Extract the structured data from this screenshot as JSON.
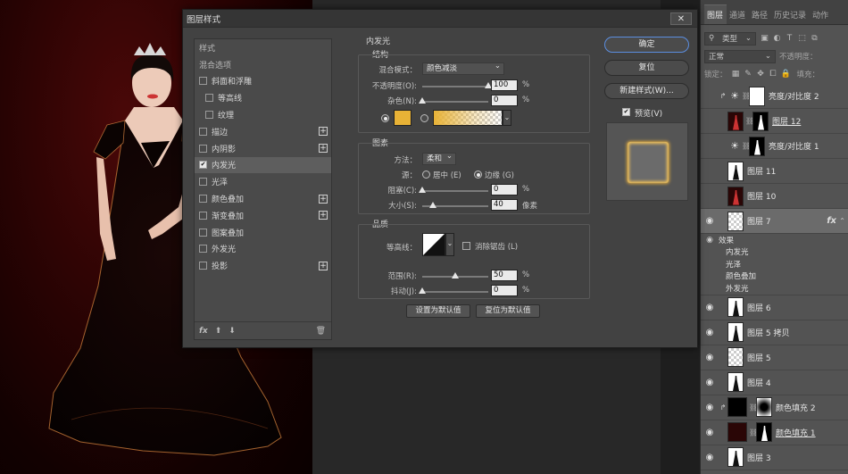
{
  "colors": {
    "accent": "#5b8ee0",
    "glow": "#e8b236",
    "panel": "#535353",
    "dialog": "#424242"
  },
  "dialog": {
    "title": "图层样式",
    "close_icon": "close-icon",
    "style_list": {
      "items": [
        {
          "label": "样式",
          "type": "head"
        },
        {
          "label": "混合选项",
          "type": "head"
        },
        {
          "label": "斜面和浮雕",
          "checked": false
        },
        {
          "label": "等高线",
          "checked": false,
          "indent": true
        },
        {
          "label": "纹理",
          "checked": false,
          "indent": true
        },
        {
          "label": "描边",
          "checked": false,
          "plus": true
        },
        {
          "label": "内阴影",
          "checked": false,
          "plus": true
        },
        {
          "label": "内发光",
          "checked": true,
          "selected": true
        },
        {
          "label": "光泽",
          "checked": false
        },
        {
          "label": "颜色叠加",
          "checked": false,
          "plus": true
        },
        {
          "label": "渐变叠加",
          "checked": false,
          "plus": true
        },
        {
          "label": "图案叠加",
          "checked": false
        },
        {
          "label": "外发光",
          "checked": false
        },
        {
          "label": "投影",
          "checked": false,
          "plus": true
        }
      ],
      "footer_fx": "fx"
    },
    "inner_glow": {
      "section_title": "内发光",
      "structure": {
        "title": "结构",
        "blend_mode_label": "混合模式：",
        "blend_mode_value": "颜色减淡",
        "opacity_label": "不透明度(O):",
        "opacity_value": "100",
        "opacity_pct": 100,
        "noise_label": "杂色(N):",
        "noise_value": "0",
        "noise_pct": 0,
        "unit": "%"
      },
      "elements": {
        "title": "图素",
        "method_label": "方法：",
        "method_value": "柔和",
        "source_label": "源：",
        "source_center": "居中 (E)",
        "source_edge": "边缘 (G)",
        "choke_label": "阻塞(C):",
        "choke_value": "0",
        "choke_pct": 0,
        "size_label": "大小(S):",
        "size_value": "40",
        "size_unit": "像素",
        "unit": "%"
      },
      "quality": {
        "title": "品质",
        "contour_label": "等高线：",
        "anti_alias_label": "消除锯齿 (L)",
        "range_label": "范围(R):",
        "range_value": "50",
        "range_pct": 50,
        "jitter_label": "抖动(J):",
        "jitter_value": "0",
        "jitter_pct": 0,
        "unit": "%"
      },
      "set_default": "设置为默认值",
      "reset_default": "复位为默认值"
    },
    "buttons": {
      "ok": "确定",
      "reset": "复位",
      "new_style": "新建样式(W)...",
      "preview": "预览(V)"
    }
  },
  "layers_panel": {
    "tabs": [
      "图层",
      "通道",
      "路径",
      "历史记录",
      "动作"
    ],
    "filter_kind": "类型",
    "blend_mode": "正常",
    "opacity_label": "不透明度：",
    "lock_label": "锁定：",
    "fill_label": "填充：",
    "layers": [
      {
        "name": "亮度/对比度 2",
        "visible": false,
        "clip": true,
        "kind": "adjust",
        "mask": "white"
      },
      {
        "name": "图层 12",
        "visible": false,
        "clip": false,
        "kind": "dark",
        "mask": "figure",
        "underline": true
      },
      {
        "name": "亮度/对比度 1",
        "visible": false,
        "clip": false,
        "kind": "adjust",
        "mask": "figure"
      },
      {
        "name": "图层 11",
        "visible": false,
        "clip": false,
        "kind": "white"
      },
      {
        "name": "图层 10",
        "visible": false,
        "clip": false,
        "kind": "dark"
      },
      {
        "name": "图层 7",
        "visible": true,
        "clip": false,
        "kind": "checker",
        "selected": true,
        "fx": "fx"
      }
    ],
    "effects_title": "效果",
    "effects": [
      "内发光",
      "光泽",
      "颜色叠加",
      "外发光"
    ],
    "layers_after": [
      {
        "name": "图层 6",
        "visible": true,
        "kind": "white"
      },
      {
        "name": "图层 5 拷贝",
        "visible": true,
        "kind": "white"
      },
      {
        "name": "图层 5",
        "visible": true,
        "kind": "checker"
      },
      {
        "name": "图层 4",
        "visible": true,
        "kind": "white"
      },
      {
        "name": "颜色填充 2",
        "visible": true,
        "clip": true,
        "kind": "black",
        "mask": "radial"
      },
      {
        "name": "颜色填充 1",
        "visible": true,
        "kind": "dark",
        "mask": "figure",
        "underline": true
      },
      {
        "name": "图层 3",
        "visible": true,
        "kind": "white"
      }
    ]
  }
}
